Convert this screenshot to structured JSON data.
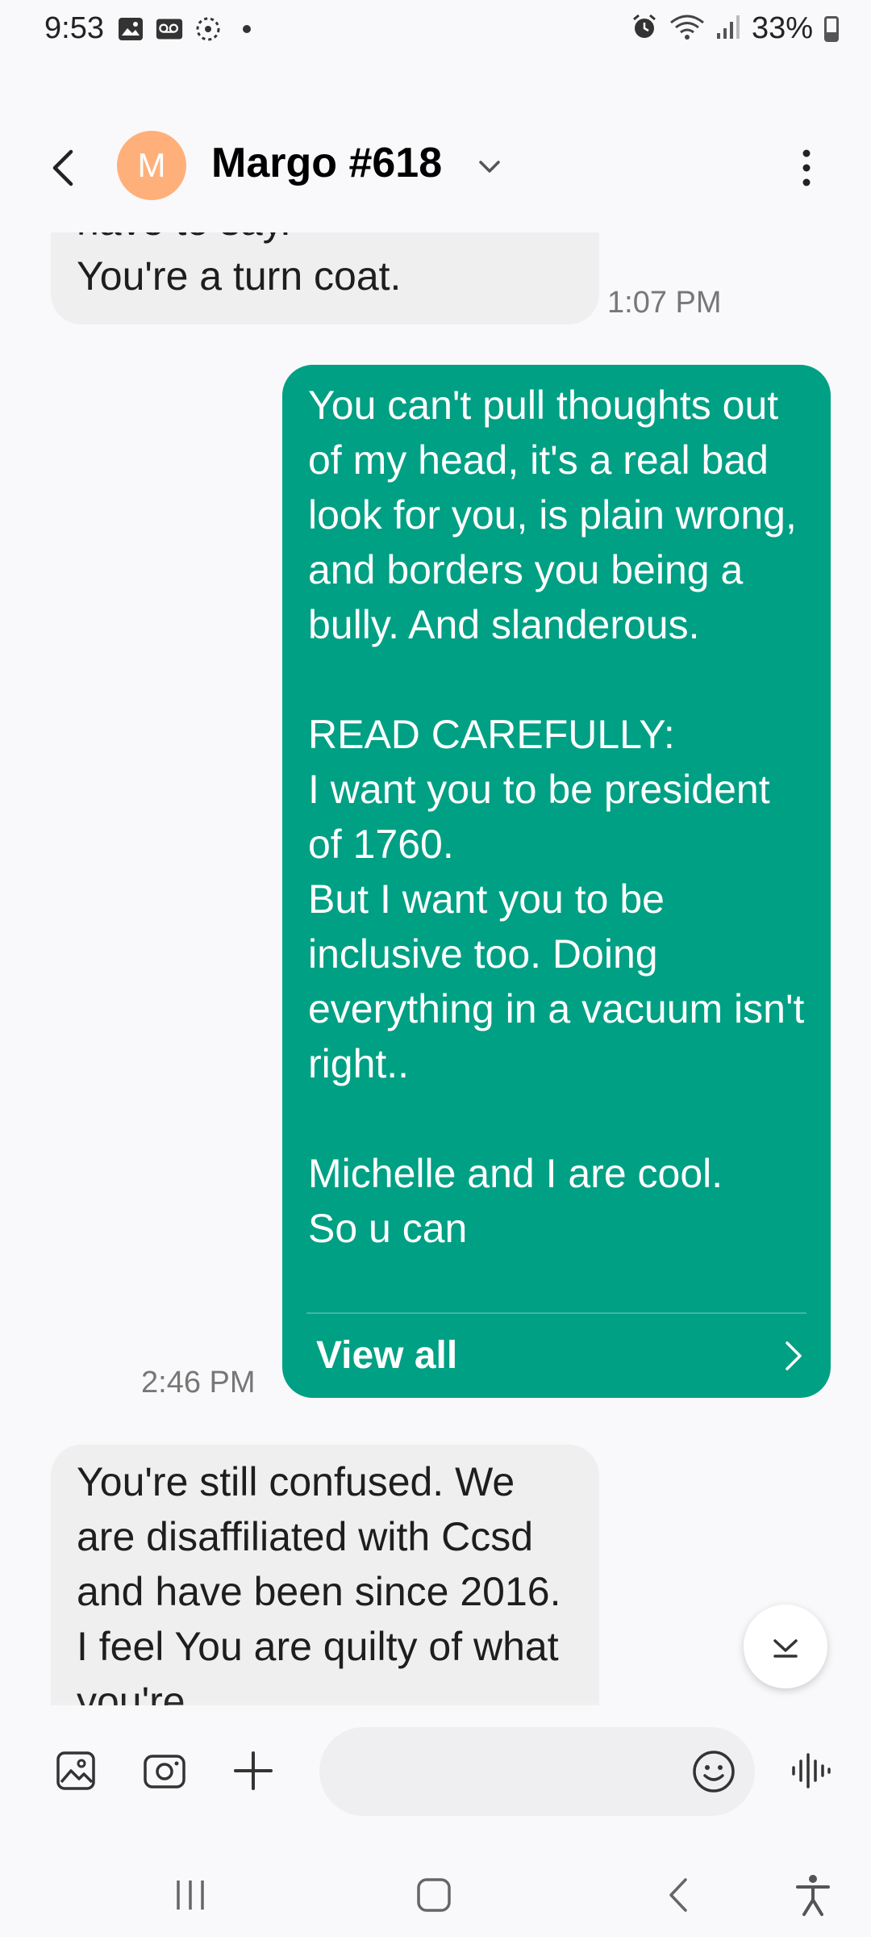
{
  "status_bar": {
    "time": "9:53",
    "battery": "33%",
    "battery_level": 0.33,
    "icons_left": [
      "image-notification-icon",
      "voicemail-icon",
      "sync-icon",
      "dot-icon"
    ],
    "icons_right": [
      "alarm-icon",
      "wifi-icon",
      "signal-icon",
      "battery-icon"
    ]
  },
  "header": {
    "avatar_letter": "M",
    "avatar_color": "#ffb07a",
    "contact_name": "Margo #618"
  },
  "messages": [
    {
      "direction": "incoming",
      "text": "have to say.\nYou're a turn coat.",
      "time": "1:07 PM"
    },
    {
      "direction": "outgoing",
      "text": "You can't pull thoughts out of my head, it's a real bad look for you, is plain wrong, and borders you being a bully. And slanderous.\n\nREAD CAREFULLY:\nI want you to be president of 1760.\nBut I want you to be inclusive too. Doing everything in a vacuum isn't right..\n\nMichelle and I are cool.\nSo u can",
      "view_all_label": "View all",
      "time": "2:46 PM"
    },
    {
      "direction": "incoming",
      "text": "You're still confused. We are disaffiliated with Ccsd and have been since 2016.\nI feel You are quilty of what you're\nme off"
    }
  ],
  "colors": {
    "outgoing_bubble": "#00a084",
    "incoming_bubble": "#efefef",
    "background": "#f9f9fb"
  }
}
